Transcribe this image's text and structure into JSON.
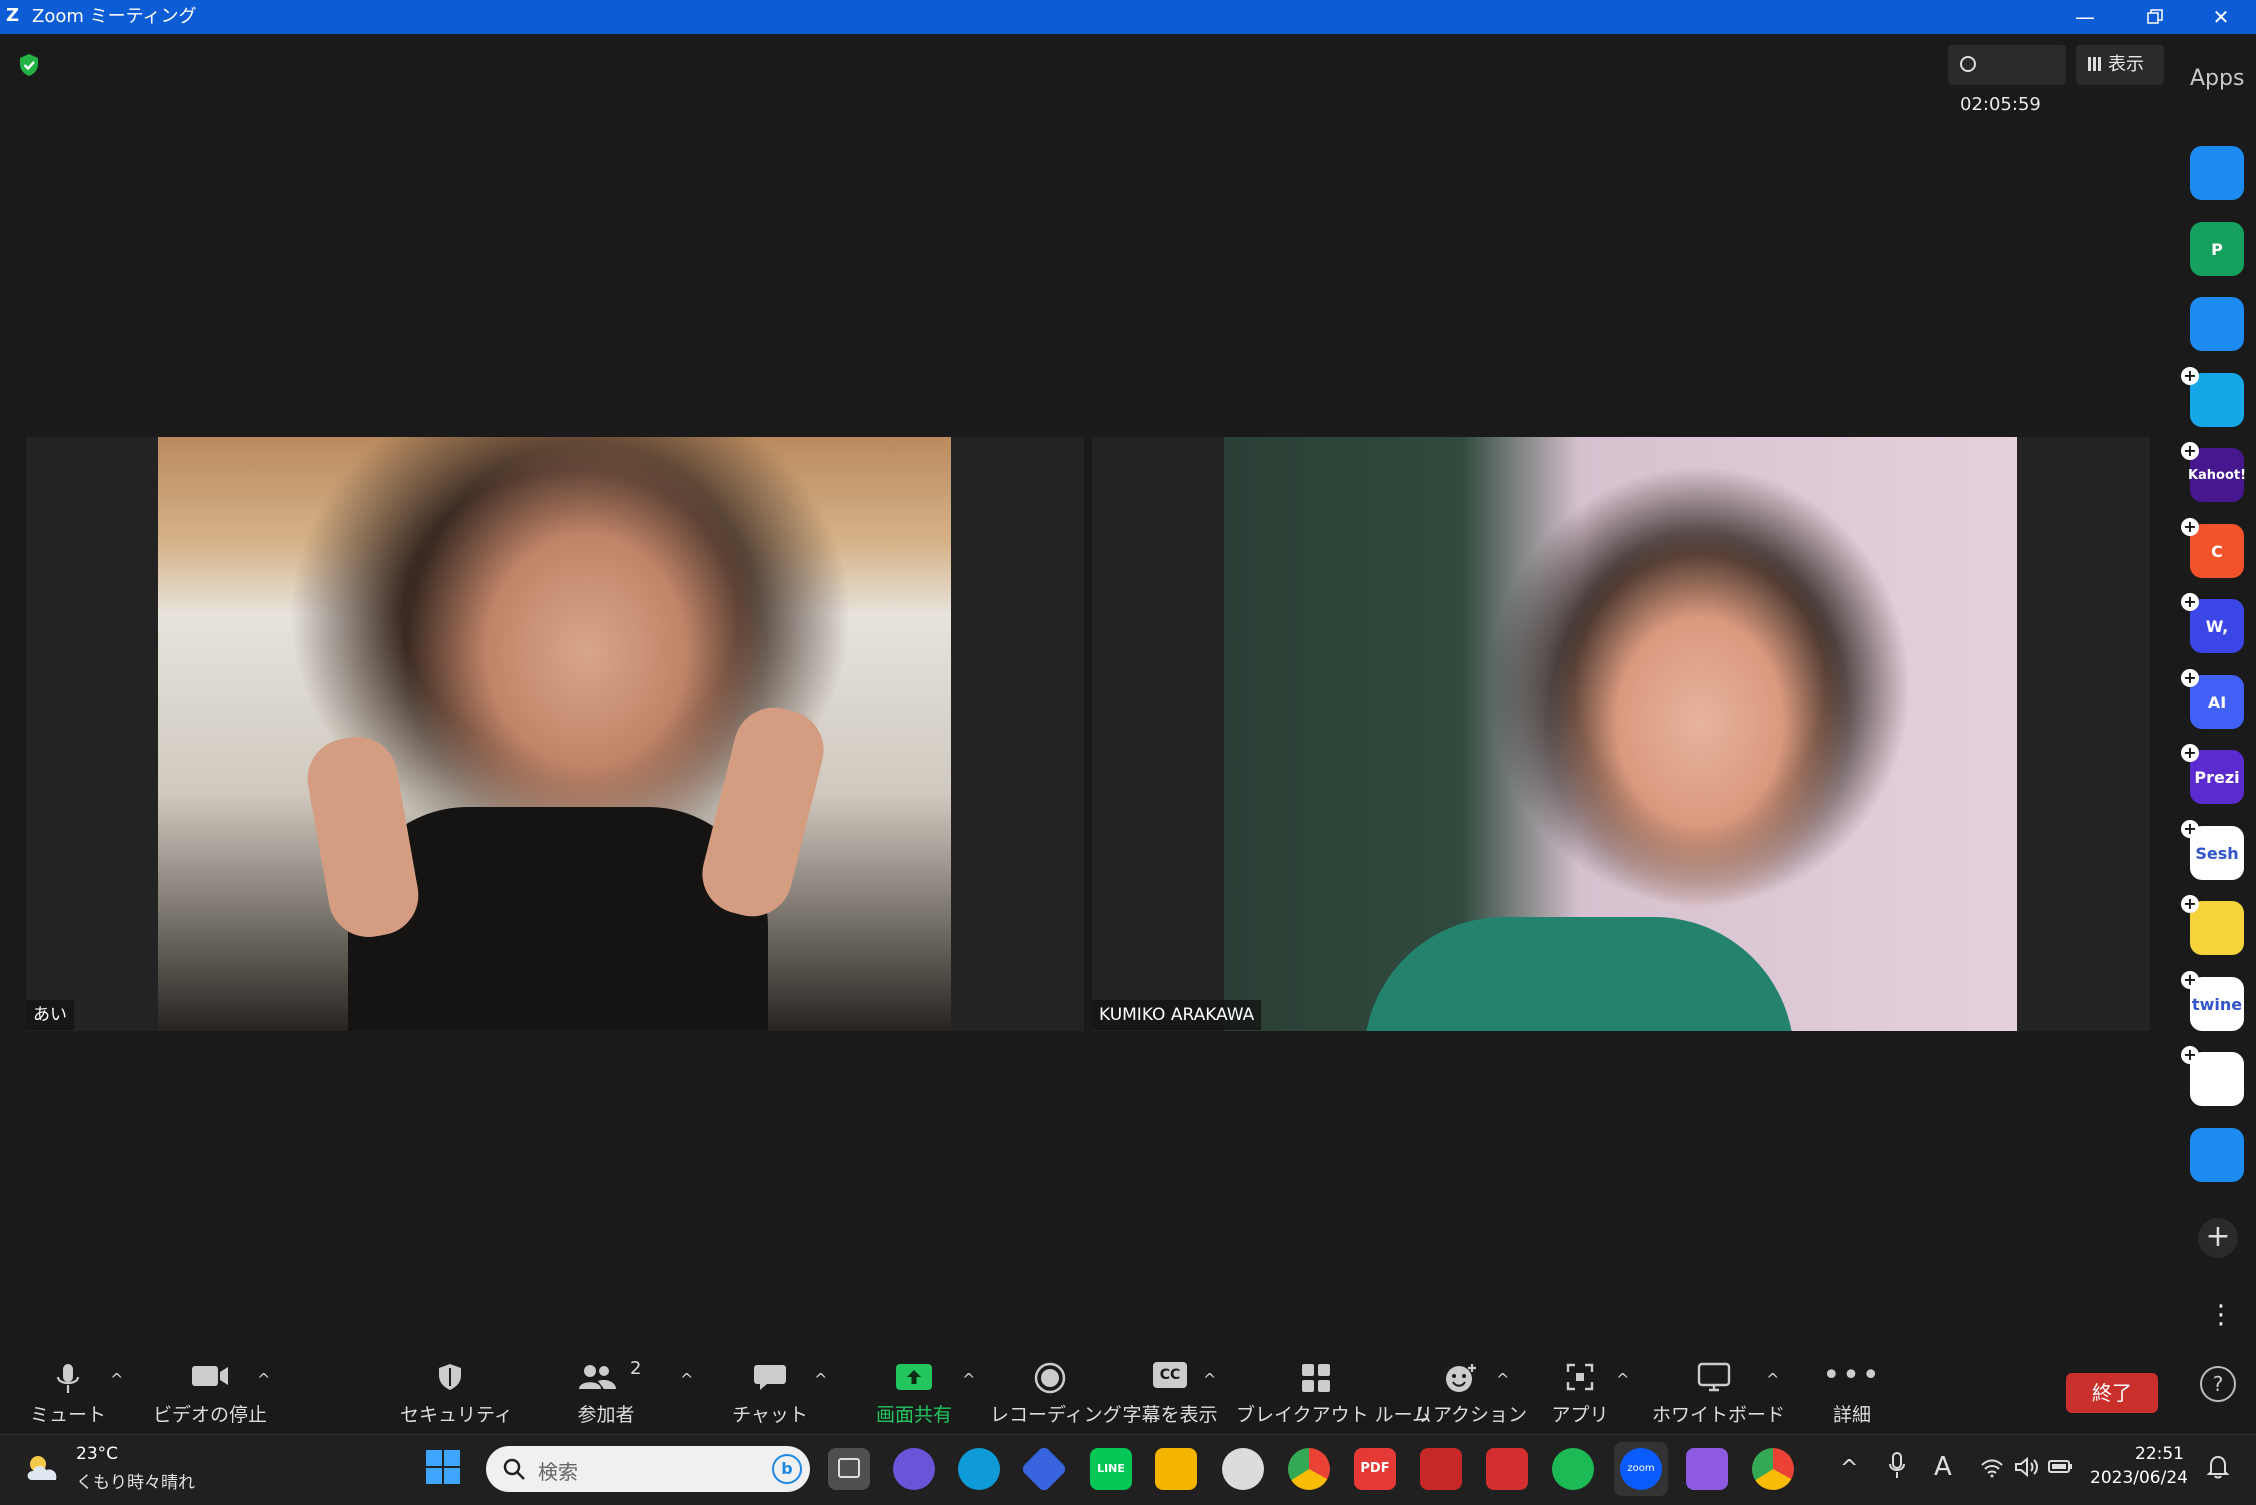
{
  "window": {
    "app_logo": "Z",
    "title": "Zoom ミーティング",
    "controls": [
      "minimize-icon",
      "restore-icon",
      "close-icon"
    ]
  },
  "meeting": {
    "timer": "02:05:59",
    "view_label": "表示",
    "apps_label": "Apps"
  },
  "participants": [
    {
      "name": "あい"
    },
    {
      "name": "KUMIKO ARAKAWA"
    }
  ],
  "apps_rail": [
    {
      "label": "",
      "icon": "smiley-app-icon",
      "color": "#1d8bf1"
    },
    {
      "label": "P",
      "icon": "p-app-icon",
      "color": "#16a05e"
    },
    {
      "label": "",
      "icon": "timer-app-icon",
      "color": "#1d8bf1"
    },
    {
      "label": "",
      "icon": "flag-app-icon",
      "color": "#15a7e8"
    },
    {
      "label": "Kahoot!",
      "icon": "kahoot-icon",
      "color": "#46178f"
    },
    {
      "label": "C",
      "icon": "c-app-icon",
      "color": "#f3532a"
    },
    {
      "label": "W,",
      "icon": "wooclap-icon",
      "color": "#3b46e6"
    },
    {
      "label": "AI",
      "icon": "ai-app-icon",
      "color": "#4161f6"
    },
    {
      "label": "Prezi",
      "icon": "prezi-icon",
      "color": "#5b2bcf"
    },
    {
      "label": "Sesh",
      "icon": "sesh-icon",
      "color": "#ffffff"
    },
    {
      "label": "",
      "icon": "emoji-app-icon",
      "color": "#f6d33a"
    },
    {
      "label": "twine",
      "icon": "twine-icon",
      "color": "#ffffff"
    },
    {
      "label": "",
      "icon": "blocks-app-icon",
      "color": "#ffffff"
    },
    {
      "label": "",
      "icon": "stopwatch-app-icon",
      "color": "#1d8bf1"
    }
  ],
  "toolbar": {
    "mute": "ミュート",
    "video": "ビデオの停止",
    "security": "セキュリティ",
    "participants": "参加者",
    "participants_count": "2",
    "chat": "チャット",
    "share": "画面共有",
    "record": "レコーディング",
    "captions": "字幕を表示",
    "captions_icon_text": "CC",
    "breakout": "ブレイクアウト ルーム",
    "reactions": "リアクション",
    "apps": "アプリ",
    "whiteboard": "ホワイトボード",
    "more": "詳細",
    "end": "終了"
  },
  "taskbar": {
    "weather_temp": "23°C",
    "weather_desc": "くもり時々晴れ",
    "search_placeholder": "検索",
    "clock_time": "22:51",
    "clock_date": "2023/06/24",
    "pdf_label": "PDF",
    "line_label": "LINE",
    "zoom_label": "zoom"
  }
}
